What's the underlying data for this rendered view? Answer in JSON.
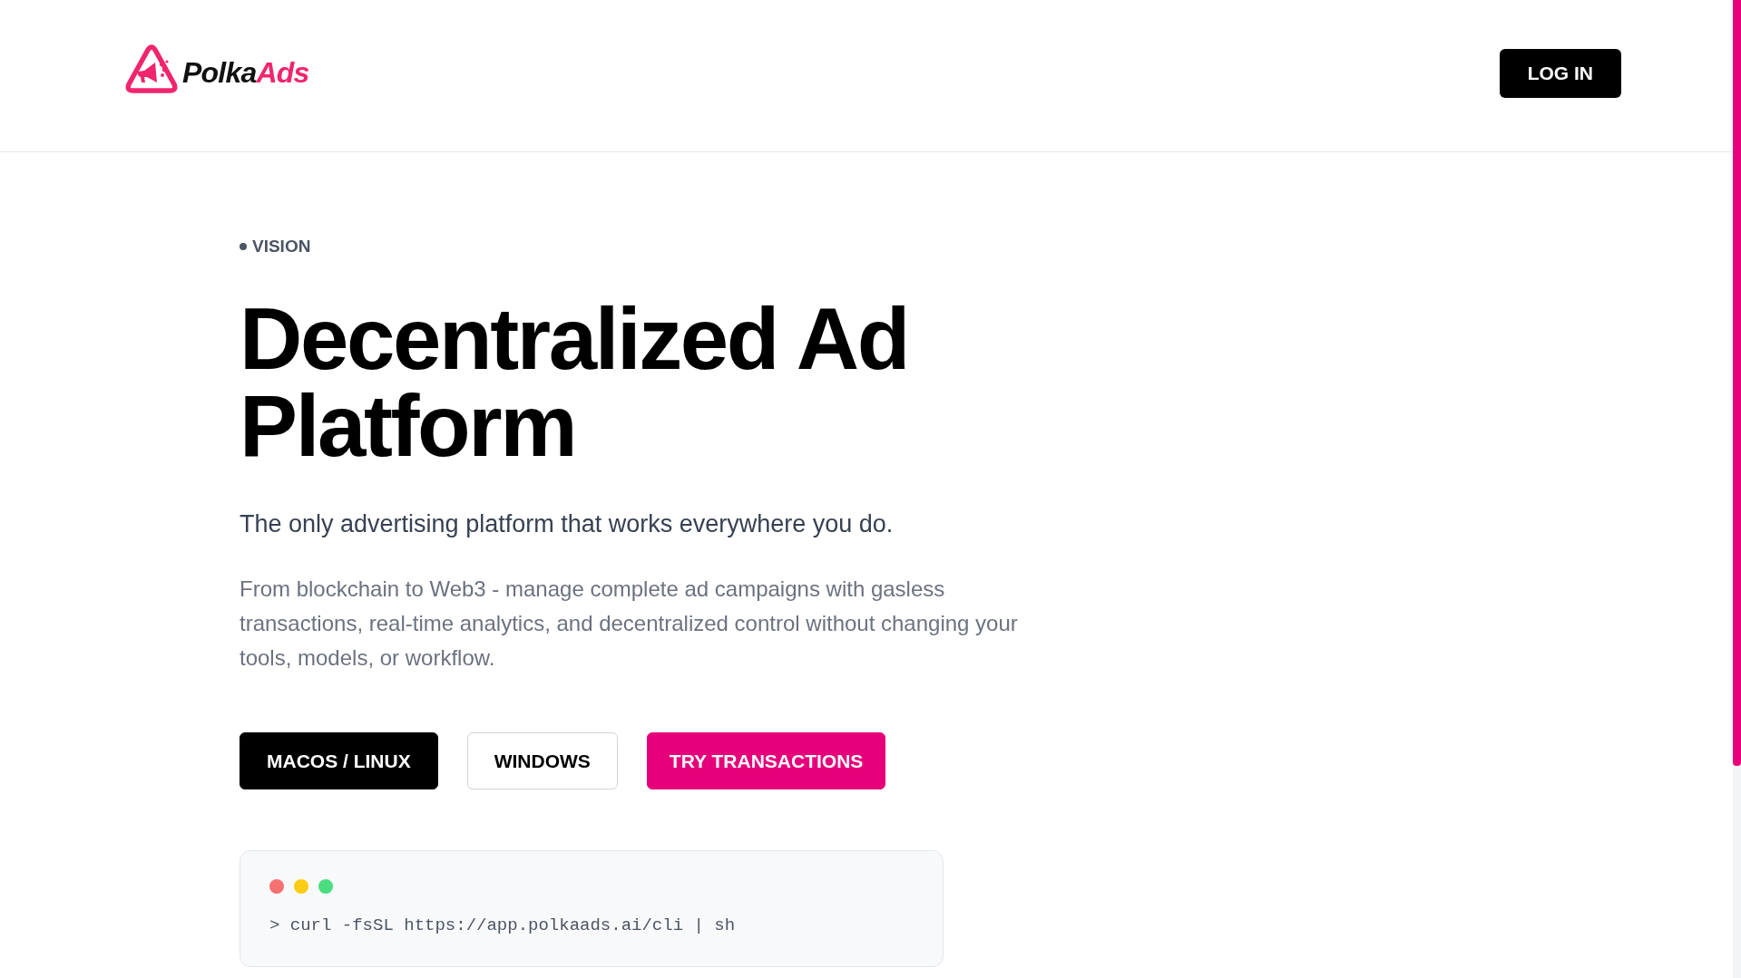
{
  "header": {
    "logo": {
      "word": "Polka",
      "accent_word": "Ads"
    },
    "login_button": "LOG IN"
  },
  "hero": {
    "eyebrow": "VISION",
    "title": "Decentralized Ad Platform",
    "subtitle": "The only advertising platform that works everywhere you do.",
    "description": "From blockchain to Web3 - manage complete ad campaigns with gasless transactions, real-time analytics, and decentralized control without changing your tools, models, or workflow.",
    "os_tabs": [
      {
        "label": "MACOS / LINUX",
        "selected": true
      },
      {
        "label": "WINDOWS",
        "selected": false
      }
    ],
    "cta_button": "TRY TRANSACTIONS",
    "terminal": {
      "command": "> curl -fsSL https://app.polkaads.ai/cli | sh"
    }
  }
}
